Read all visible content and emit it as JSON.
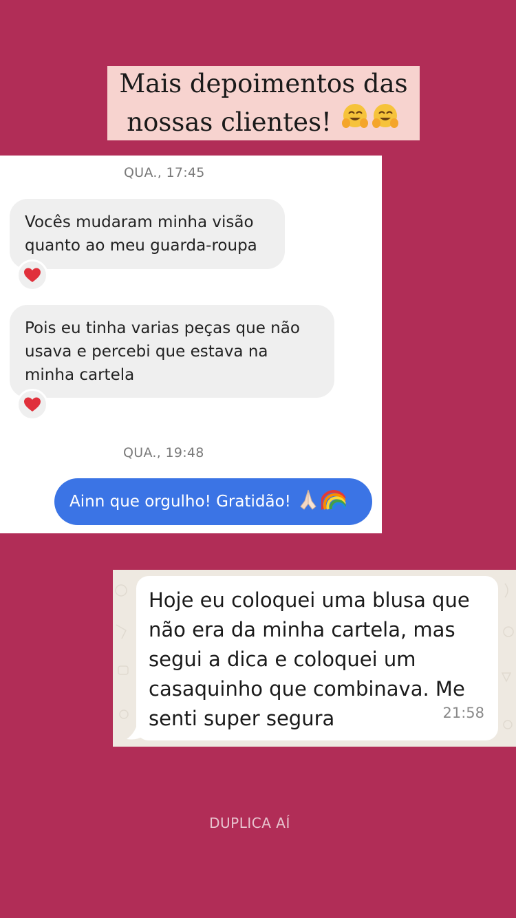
{
  "title": {
    "line1": "Mais depoimentos das",
    "line2": "nossas clientes!",
    "emoji": "hugging-face x2"
  },
  "chat1": {
    "timestamp1": "QUA., 17:45",
    "message1": "Vocês mudaram minha visão quanto ao meu guarda-roupa",
    "reaction1": "heart",
    "message2": "Pois eu tinha varias peças que não usava e percebi  que estava na minha cartela",
    "reaction2": "heart",
    "timestamp2": "QUA., 19:48",
    "reply": "Ainn que orgulho! Gratidão!",
    "reply_emoji": [
      "folded-hands",
      "rainbow"
    ]
  },
  "chat2": {
    "message": "Hoje eu coloquei uma blusa que não  era da minha cartela, mas segui a dica e coloquei um casaquinho que combinava. Me senti super segura",
    "time": "21:58"
  },
  "footer": "DUPLICA AÍ",
  "colors": {
    "background": "#B12D57",
    "title_box": "#F7D3CF",
    "outgoing_bubble": "#3B74E5",
    "incoming_bubble": "#EFEFEF",
    "whatsapp_bg": "#EEE9E1"
  }
}
